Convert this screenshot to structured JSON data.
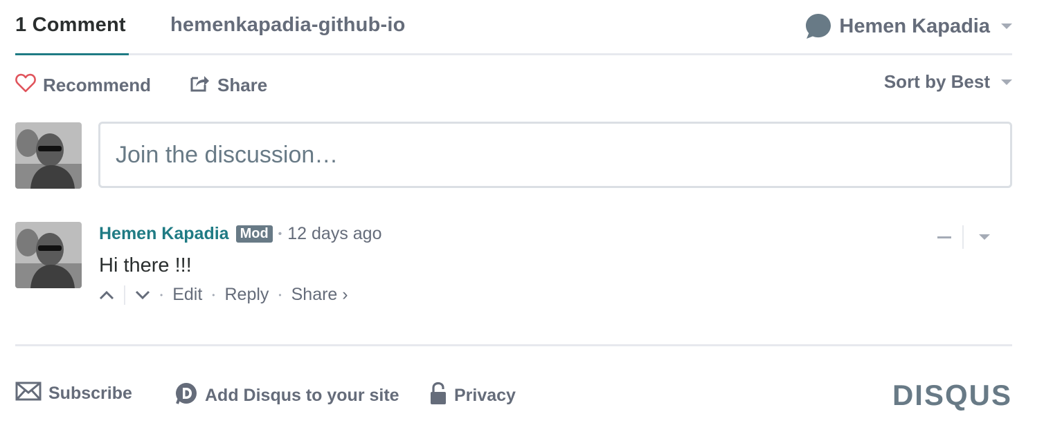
{
  "nav": {
    "comment_count_tab": "1 Comment",
    "forum_tab": "hemenkapadia-github-io",
    "user_name": "Hemen Kapadia"
  },
  "toolbar": {
    "recommend_label": "Recommend",
    "share_label": "Share",
    "sort_label": "Sort by Best"
  },
  "composer": {
    "placeholder": "Join the discussion…"
  },
  "comment": {
    "author": "Hemen Kapadia",
    "badge": "Mod",
    "separator": "•",
    "time": "12 days ago",
    "body": "Hi there !!!",
    "actions": {
      "edit": "Edit",
      "reply": "Reply",
      "share": "Share ›"
    }
  },
  "footer": {
    "subscribe": "Subscribe",
    "add_disqus": "Add Disqus to your site",
    "privacy": "Privacy",
    "logo": "DISQUS"
  },
  "colors": {
    "accent": "#1f7b84",
    "text_muted": "#656c7a",
    "heart": "#e0545c",
    "divider": "#e7e9ee"
  },
  "icons": [
    "heart-icon",
    "share-icon",
    "chat-bubble-icon",
    "chevron-up-icon",
    "chevron-down-icon",
    "minus-icon",
    "envelope-icon",
    "disqus-d-icon",
    "lock-icon"
  ]
}
